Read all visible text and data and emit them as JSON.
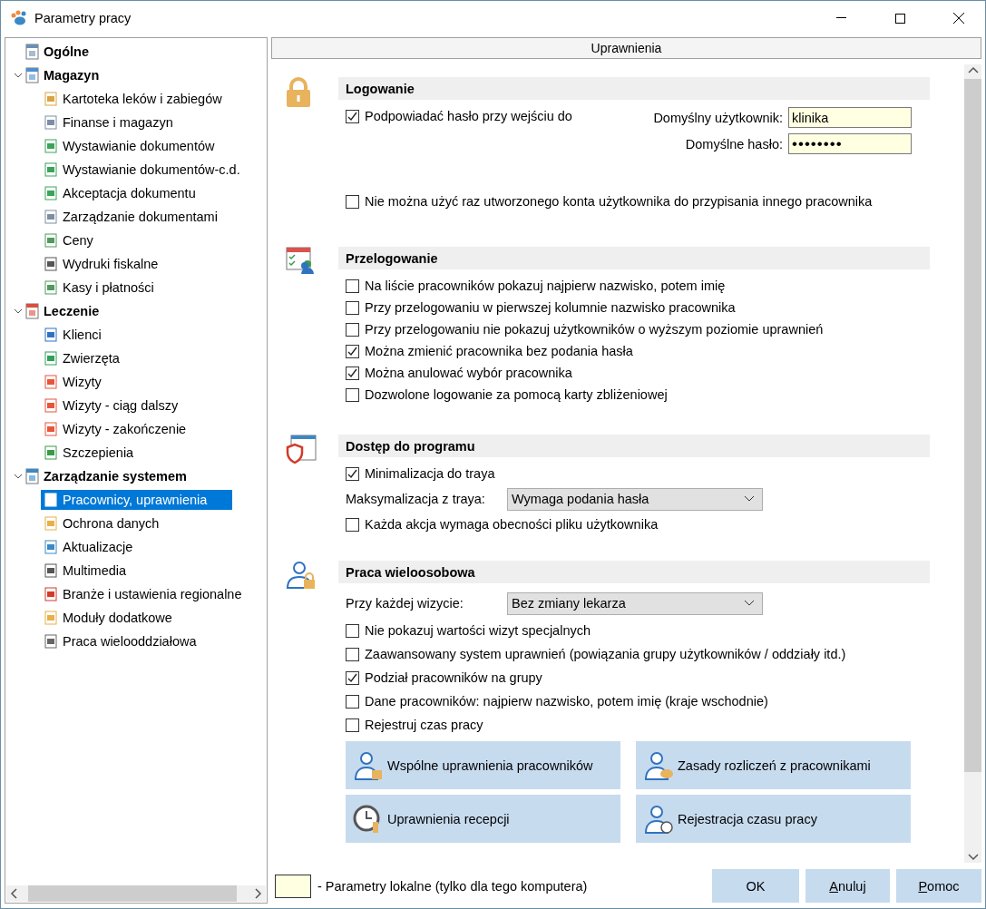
{
  "window": {
    "title": "Parametry pracy"
  },
  "tree": [
    {
      "label": "Ogólne",
      "selected": false
    },
    {
      "label": "Magazyn",
      "expanded": true,
      "selected": false,
      "children": [
        {
          "label": "Kartoteka leków i zabiegów",
          "selected": false
        },
        {
          "label": "Finanse i magazyn",
          "selected": false
        },
        {
          "label": "Wystawianie dokumentów",
          "selected": false
        },
        {
          "label": "Wystawianie dokumentów-c.d.",
          "selected": false
        },
        {
          "label": "Akceptacja dokumentu",
          "selected": false
        },
        {
          "label": "Zarządzanie dokumentami",
          "selected": false
        },
        {
          "label": "Ceny",
          "selected": false
        },
        {
          "label": "Wydruki fiskalne",
          "selected": false
        },
        {
          "label": "Kasy i płatności",
          "selected": false
        }
      ]
    },
    {
      "label": "Leczenie",
      "expanded": true,
      "selected": false,
      "children": [
        {
          "label": "Klienci",
          "selected": false
        },
        {
          "label": "Zwierzęta",
          "selected": false
        },
        {
          "label": "Wizyty",
          "selected": false
        },
        {
          "label": "Wizyty - ciąg dalszy",
          "selected": false
        },
        {
          "label": "Wizyty - zakończenie",
          "selected": false
        },
        {
          "label": "Szczepienia",
          "selected": false
        }
      ]
    },
    {
      "label": "Zarządzanie systemem",
      "expanded": true,
      "selected": false,
      "children": [
        {
          "label": "Pracownicy, uprawnienia",
          "selected": true
        },
        {
          "label": "Ochrona danych",
          "selected": false
        },
        {
          "label": "Aktualizacje",
          "selected": false
        },
        {
          "label": "Multimedia",
          "selected": false
        },
        {
          "label": "Branże i ustawienia regionalne",
          "selected": false
        },
        {
          "label": "Moduły dodatkowe",
          "selected": false
        },
        {
          "label": "Praca wielooddziałowa",
          "selected": false
        }
      ]
    }
  ],
  "panel": {
    "title": "Uprawnienia"
  },
  "sections": [
    {
      "kind": "login",
      "title": "Logowanie",
      "items": [
        {
          "kind": "checkbox_fields",
          "label": "Podpowiadać hasło przy wejściu do",
          "checked": true,
          "fields": [
            {
              "label": "Domyślny użytkownik:",
              "value": "klinika",
              "local": true
            },
            {
              "label": "Domyślne hasło:",
              "value": "••••••••",
              "local": true
            }
          ]
        },
        {
          "kind": "checkbox",
          "label": "Nie można użyć raz utworzonego konta użytkownika do przypisania innego pracownika",
          "checked": false
        }
      ]
    },
    {
      "kind": "relogin",
      "title": "Przelogowanie",
      "items": [
        {
          "kind": "checkbox",
          "label": "Na liście pracowników pokazuj najpierw nazwisko, potem imię",
          "checked": false
        },
        {
          "kind": "checkbox",
          "label": "Przy przelogowaniu w pierwszej kolumnie nazwisko pracownika",
          "checked": false
        },
        {
          "kind": "checkbox",
          "label": "Przy przelogowaniu nie pokazuj użytkowników o wyższym poziomie uprawnień",
          "checked": false
        },
        {
          "kind": "checkbox",
          "label": "Można zmienić pracownika bez podania hasła",
          "checked": true
        },
        {
          "kind": "checkbox",
          "label": "Można anulować wybór pracownika",
          "checked": true
        },
        {
          "kind": "checkbox",
          "label": "Dozwolone logowanie za pomocą karty zbliżeniowej",
          "checked": false
        }
      ]
    },
    {
      "kind": "access",
      "title": "Dostęp do programu",
      "items": [
        {
          "kind": "checkbox",
          "label": "Minimalizacja do traya",
          "checked": true
        },
        {
          "kind": "select",
          "label": "Maksymalizacja z traya:",
          "value": "Wymaga podania hasła"
        },
        {
          "kind": "checkbox",
          "label": "Każda akcja wymaga obecności pliku użytkownika",
          "checked": false
        }
      ]
    },
    {
      "kind": "multiuser",
      "title": "Praca wieloosobowa",
      "items": [
        {
          "kind": "select",
          "label": "Przy każdej wizycie:",
          "value": "Bez zmiany lekarza"
        },
        {
          "kind": "checkbox",
          "label": "Nie pokazuj wartości wizyt specjalnych",
          "checked": false
        },
        {
          "kind": "checkbox",
          "label": "Zaawansowany system uprawnień (powiązania grupy użytkowników / oddziały itd.)",
          "checked": false
        },
        {
          "kind": "checkbox",
          "label": "Podział pracowników na grupy",
          "checked": true
        },
        {
          "kind": "checkbox",
          "label": "Dane pracowników: najpierw nazwisko, potem imię (kraje wschodnie)",
          "checked": false
        },
        {
          "kind": "checkbox",
          "label": "Rejestruj czas pracy",
          "checked": false
        },
        {
          "kind": "buttons",
          "buttons": [
            "Wspólne uprawnienia pracowników",
            "Zasady rozliczeń z pracownikami",
            "Uprawnienia recepcji",
            "Rejestracja czasu pracy"
          ]
        }
      ]
    }
  ],
  "legend": {
    "text": "- Parametry lokalne (tylko dla tego komputera)"
  },
  "buttons": [
    {
      "label": "OK",
      "mnemonic": false
    },
    {
      "label": "Anuluj",
      "mnemonic": true
    },
    {
      "label": "Pomoc",
      "mnemonic": true
    }
  ]
}
